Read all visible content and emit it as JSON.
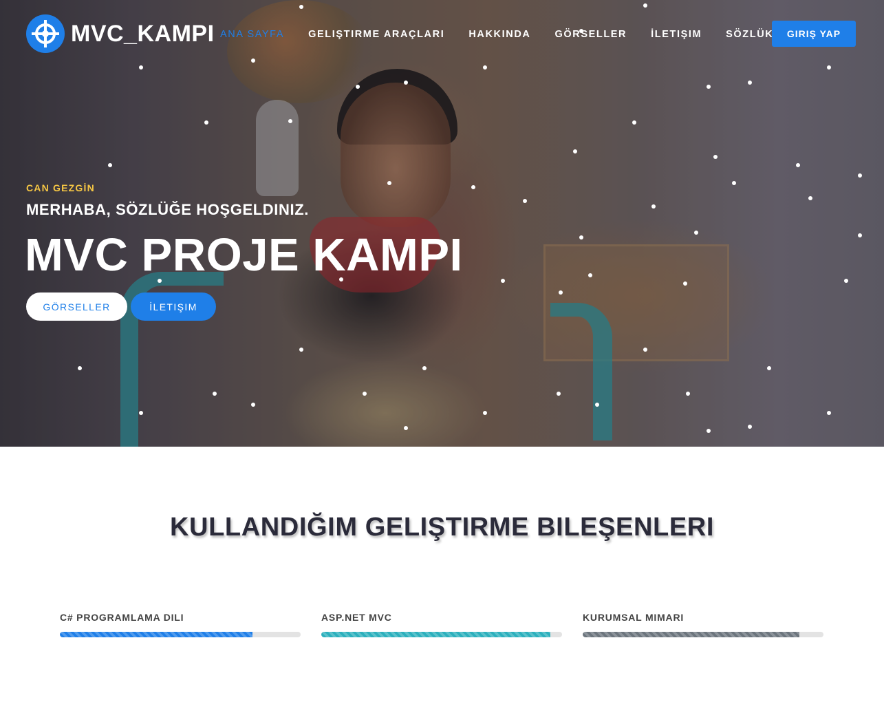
{
  "brand": {
    "name": "MVC_KAMPI",
    "icon": "crosshair-icon",
    "accent": "#1f7fe8"
  },
  "nav": {
    "items": [
      {
        "label": "ANA SAYFA",
        "active": true
      },
      {
        "label": "GELIŞTIRME ARAÇLARI",
        "active": false
      },
      {
        "label": "HAKKINDA",
        "active": false
      },
      {
        "label": "GÖRSELLER",
        "active": false
      },
      {
        "label": "İLETIŞIM",
        "active": false
      },
      {
        "label": "SÖZLÜK",
        "active": false
      }
    ],
    "login_label": "GIRIŞ YAP"
  },
  "hero": {
    "subtitle": "CAN GEZGİN",
    "subtitle_color": "#f6c744",
    "welcome": "MERHABA, SÖZLÜĞE HOŞGELDINIZ.",
    "title": "MVC PROJE KAMPI",
    "buttons": {
      "gallery": "GÖRSELLER",
      "contact": "İLETIŞIM"
    }
  },
  "skills_section": {
    "title": "KULLANDIĞIM GELIŞTIRME BILEŞENLERI",
    "skills": [
      {
        "label": "C# PROGRAMLAMA DILI",
        "progress": 0.8,
        "color": "#1f7fe8"
      },
      {
        "label": "ASP.NET MVC",
        "progress": 0.95,
        "color": "#2bb0bd"
      },
      {
        "label": "KURUMSAL MIMARI",
        "progress": 0.9,
        "color": "#6c757d"
      }
    ]
  }
}
